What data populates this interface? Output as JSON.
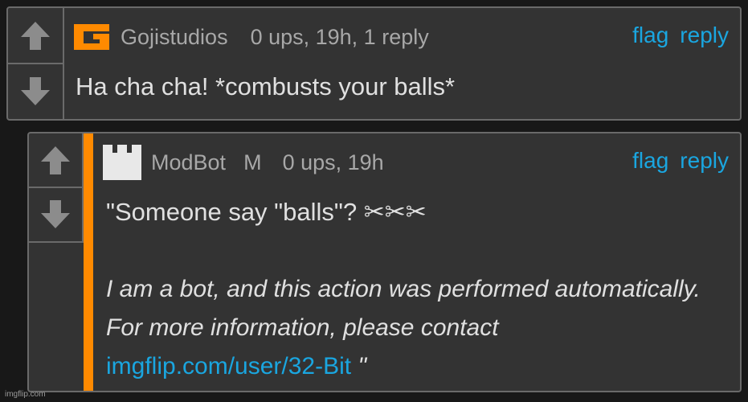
{
  "comments": [
    {
      "username": "Gojistudios",
      "meta": "0 ups, 19h, 1 reply",
      "flag": "flag",
      "reply": "reply",
      "text": "Ha cha cha! *combusts your balls*"
    },
    {
      "username": "ModBot",
      "mod_badge": "M",
      "meta": "0 ups, 19h",
      "flag": "flag",
      "reply": "reply",
      "text_line1": "\"Someone say \"balls\"? ✂✂✂",
      "text_italic": "I am a bot, and this action was performed automatically. For more information, please contact",
      "link": "imgflip.com/user/32-Bit",
      "closing_quote": " \""
    }
  ],
  "watermark": "imgflip.com",
  "colors": {
    "accent_blue": "#1aa6e0",
    "orange": "#ff8a00",
    "panel": "#333333",
    "background": "#181818"
  },
  "icons": [
    "upvote-arrow-icon",
    "downvote-arrow-icon",
    "goji-logo-icon",
    "castle-avatar-icon",
    "scissors-icon"
  ]
}
